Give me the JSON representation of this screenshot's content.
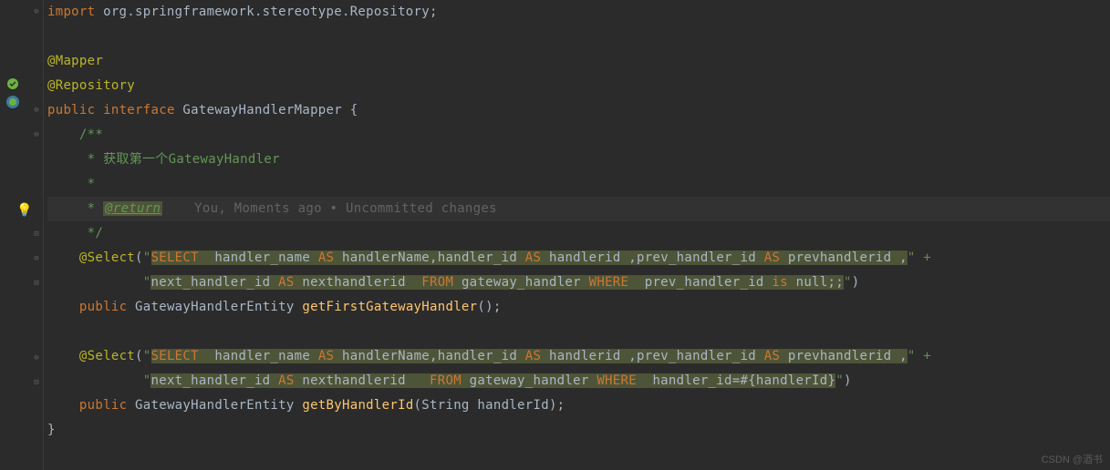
{
  "import_kw": "import",
  "import_pkg": " org.springframework.stereotype.Repository",
  "import_semi": ";",
  "anno_mapper": "@Mapper",
  "anno_repository": "@Repository",
  "public_kw": "public",
  "interface_kw": "interface",
  "class_name": "GatewayHandlerMapper",
  "open_brace": "{",
  "doc_open": "/**",
  "doc_star": " *",
  "doc_line1": " * 获取第一个GatewayHandler",
  "doc_return_star": " * ",
  "doc_return_tag": "@return",
  "inline_author": "    You, Moments ago • Uncommitted changes",
  "doc_close": " */",
  "select_anno": "@Select",
  "open_paren": "(",
  "sql1_part1_pre": "\"",
  "sql1_part1": "SELECT  handler_name ",
  "sql1_as": "AS",
  "sql1_hn": " handlerName",
  "sql1_comma1": ",",
  "sql1_hi": "handler_id ",
  "sql1_hialias": " handlerid ",
  "sql1_comma2": ",",
  "sql1_phi": "prev_handler_id ",
  "sql1_phialias": " prevhandlerid ",
  "sql1_comma3": ",",
  "sql1_end": "\" +",
  "sql1_line2_pre": "\"",
  "sql1_line2_nh": "next_handler_id ",
  "sql1_line2_nhalias": " nexthandlerid  ",
  "sql1_from": " FROM ",
  "sql1_table": "gateway_handler",
  "sql1_where": " WHERE  ",
  "sql1_cond": "prev_handler_id ",
  "sql1_is": "is",
  "sql1_null": " null",
  "sql1_semis": ";;",
  "sql1_closeq": "\"",
  "sql1_closep": ")",
  "method1_return": "GatewayHandlerEntity",
  "method1_name": "getFirstGatewayHandler",
  "method1_parens": "();",
  "sql2_line2_cond": "handler_id=#{handlerId}",
  "method2_return": "GatewayHandlerEntity",
  "method2_name": "getByHandlerId",
  "method2_param_type": "String",
  "method2_param_name": "handlerId",
  "method2_close": ");",
  "close_brace": "}",
  "watermark": "CSDN @酒书"
}
